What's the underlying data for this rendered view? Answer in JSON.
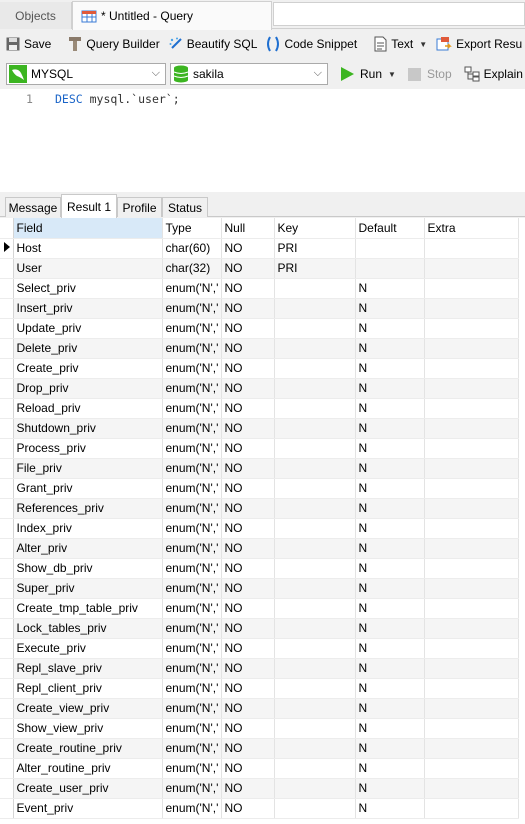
{
  "tabs": {
    "objects": "Objects",
    "query": "* Untitled - Query"
  },
  "toolbar": {
    "save": "Save",
    "query_builder": "Query Builder",
    "beautify": "Beautify SQL",
    "code_snippet": "Code Snippet",
    "text": "Text",
    "export": "Export Resu"
  },
  "connection": {
    "server": "MYSQL",
    "database": "sakila",
    "run": "Run",
    "stop": "Stop",
    "explain": "Explain"
  },
  "editor": {
    "line_number": "1",
    "keyword": "DESC",
    "rest": " mysql.`user`;"
  },
  "result_tabs": [
    "Message",
    "Result 1",
    "Profile",
    "Status"
  ],
  "active_result_tab": "Result 1",
  "grid": {
    "columns": [
      "Field",
      "Type",
      "Null",
      "Key",
      "Default",
      "Extra"
    ],
    "rows": [
      [
        "Host",
        "char(60)",
        "NO",
        "PRI",
        "",
        ""
      ],
      [
        "User",
        "char(32)",
        "NO",
        "PRI",
        "",
        ""
      ],
      [
        "Select_priv",
        "enum('N','",
        "NO",
        "",
        "N",
        ""
      ],
      [
        "Insert_priv",
        "enum('N','",
        "NO",
        "",
        "N",
        ""
      ],
      [
        "Update_priv",
        "enum('N','",
        "NO",
        "",
        "N",
        ""
      ],
      [
        "Delete_priv",
        "enum('N','",
        "NO",
        "",
        "N",
        ""
      ],
      [
        "Create_priv",
        "enum('N','",
        "NO",
        "",
        "N",
        ""
      ],
      [
        "Drop_priv",
        "enum('N','",
        "NO",
        "",
        "N",
        ""
      ],
      [
        "Reload_priv",
        "enum('N','",
        "NO",
        "",
        "N",
        ""
      ],
      [
        "Shutdown_priv",
        "enum('N','",
        "NO",
        "",
        "N",
        ""
      ],
      [
        "Process_priv",
        "enum('N','",
        "NO",
        "",
        "N",
        ""
      ],
      [
        "File_priv",
        "enum('N','",
        "NO",
        "",
        "N",
        ""
      ],
      [
        "Grant_priv",
        "enum('N','",
        "NO",
        "",
        "N",
        ""
      ],
      [
        "References_priv",
        "enum('N','",
        "NO",
        "",
        "N",
        ""
      ],
      [
        "Index_priv",
        "enum('N','",
        "NO",
        "",
        "N",
        ""
      ],
      [
        "Alter_priv",
        "enum('N','",
        "NO",
        "",
        "N",
        ""
      ],
      [
        "Show_db_priv",
        "enum('N','",
        "NO",
        "",
        "N",
        ""
      ],
      [
        "Super_priv",
        "enum('N','",
        "NO",
        "",
        "N",
        ""
      ],
      [
        "Create_tmp_table_priv",
        "enum('N','",
        "NO",
        "",
        "N",
        ""
      ],
      [
        "Lock_tables_priv",
        "enum('N','",
        "NO",
        "",
        "N",
        ""
      ],
      [
        "Execute_priv",
        "enum('N','",
        "NO",
        "",
        "N",
        ""
      ],
      [
        "Repl_slave_priv",
        "enum('N','",
        "NO",
        "",
        "N",
        ""
      ],
      [
        "Repl_client_priv",
        "enum('N','",
        "NO",
        "",
        "N",
        ""
      ],
      [
        "Create_view_priv",
        "enum('N','",
        "NO",
        "",
        "N",
        ""
      ],
      [
        "Show_view_priv",
        "enum('N','",
        "NO",
        "",
        "N",
        ""
      ],
      [
        "Create_routine_priv",
        "enum('N','",
        "NO",
        "",
        "N",
        ""
      ],
      [
        "Alter_routine_priv",
        "enum('N','",
        "NO",
        "",
        "N",
        ""
      ],
      [
        "Create_user_priv",
        "enum('N','",
        "NO",
        "",
        "N",
        ""
      ],
      [
        "Event_priv",
        "enum('N','",
        "NO",
        "",
        "N",
        ""
      ]
    ],
    "current_row": 0
  },
  "colors": {
    "run_green": "#3cb521",
    "keyword_blue": "#1a64c8",
    "header_selected": "#d8e9f8"
  }
}
